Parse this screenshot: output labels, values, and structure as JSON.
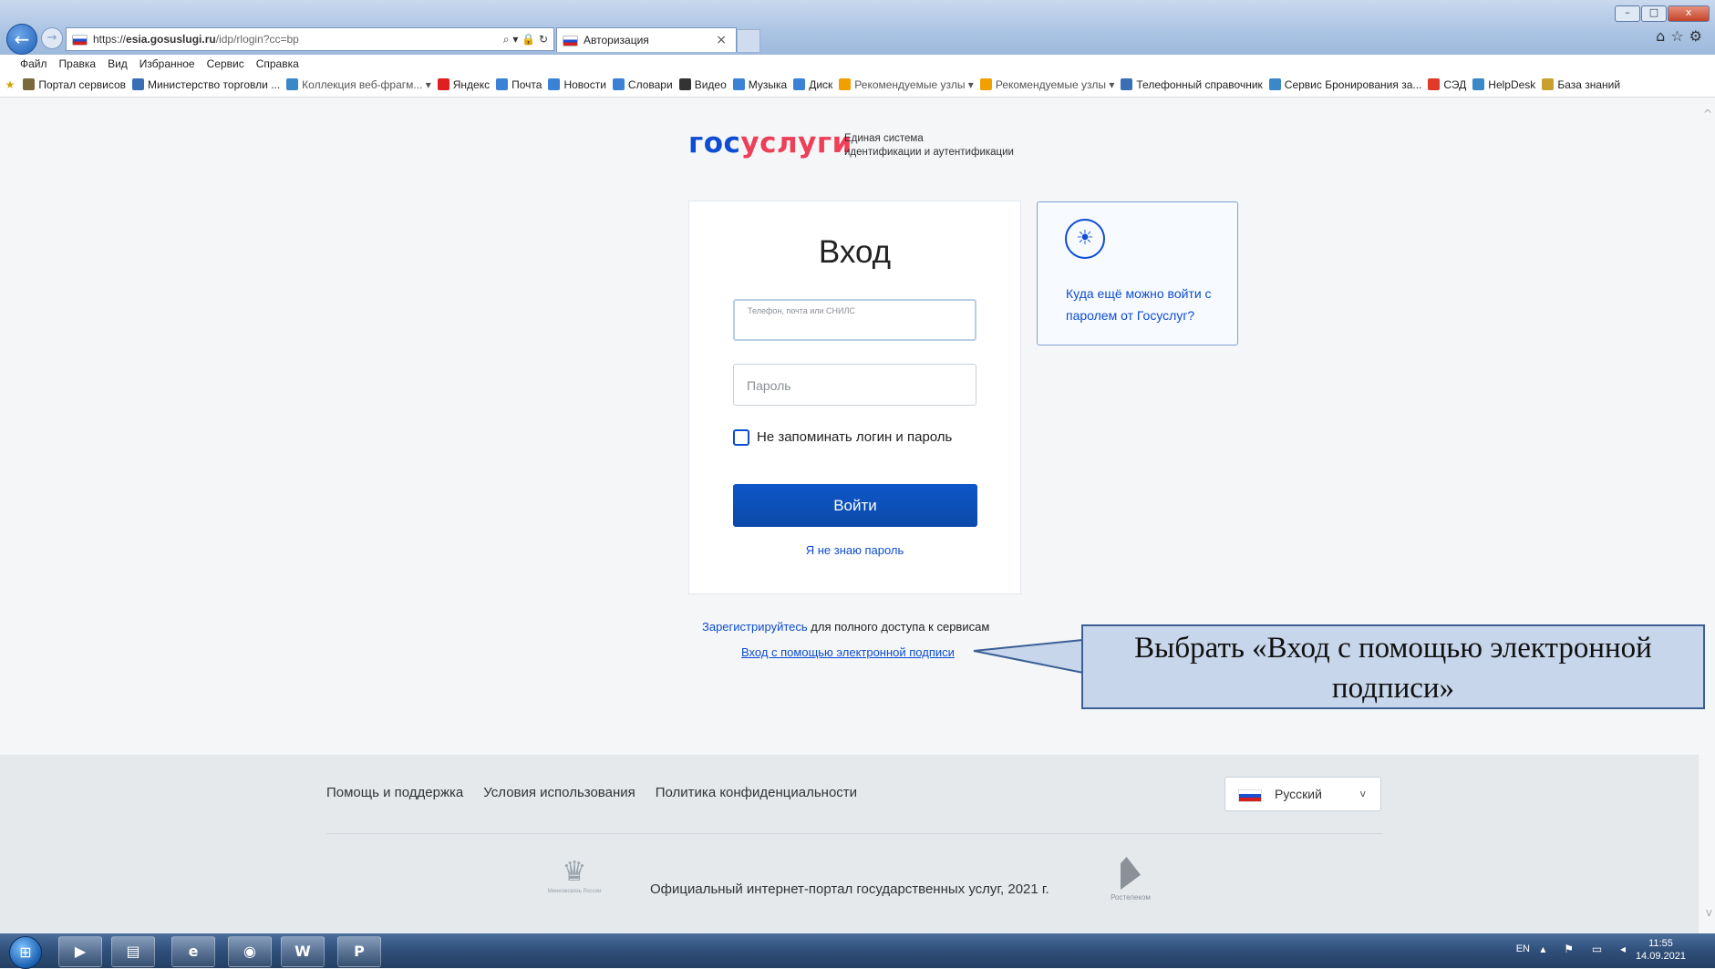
{
  "browser": {
    "url_prefix": "https://",
    "url_domain": "esia.gosuslugi.ru",
    "url_path": "/idp/rlogin?cc=bp",
    "tab_title": "Авторизация",
    "tab_close": "×",
    "window_controls": [
      "–",
      "□",
      "x"
    ],
    "menu": [
      "Файл",
      "Правка",
      "Вид",
      "Избранное",
      "Сервис",
      "Справка"
    ],
    "favorites": [
      {
        "label": "Портал сервисов",
        "color": "#7a6a3a",
        "muted": false
      },
      {
        "label": "Министерство торговли ...",
        "color": "#3a6fb5",
        "muted": false
      },
      {
        "label": "Коллекция веб-фрагм... ▾",
        "color": "#3a88c8",
        "muted": true
      },
      {
        "label": "Яндекс",
        "color": "#e02020",
        "muted": false
      },
      {
        "label": "Почта",
        "color": "#3b82d6",
        "muted": false
      },
      {
        "label": "Новости",
        "color": "#3b82d6",
        "muted": false
      },
      {
        "label": "Словари",
        "color": "#3b82d6",
        "muted": false
      },
      {
        "label": "Видео",
        "color": "#333333",
        "muted": false
      },
      {
        "label": "Музыка",
        "color": "#3b82d6",
        "muted": false
      },
      {
        "label": "Диск",
        "color": "#3b82d6",
        "muted": false
      },
      {
        "label": "Рекомендуемые узлы ▾",
        "color": "#f0a000",
        "muted": true
      },
      {
        "label": "Рекомендуемые узлы ▾",
        "color": "#f0a000",
        "muted": true
      },
      {
        "label": "Телефонный справочник",
        "color": "#3a6fb5",
        "muted": false
      },
      {
        "label": "Сервис Бронирования за...",
        "color": "#3a88c8",
        "muted": false
      },
      {
        "label": "СЭД",
        "color": "#e03a2a",
        "muted": false
      },
      {
        "label": "HelpDesk",
        "color": "#3a88c8",
        "muted": false
      },
      {
        "label": "База знаний",
        "color": "#c8a030",
        "muted": false
      }
    ]
  },
  "header": {
    "logo_part1": "гос",
    "logo_part2": "услуги",
    "subtitle_line1": "Единая система",
    "subtitle_line2": "идентификации и аутентификации"
  },
  "login": {
    "title": "Вход",
    "login_field_label": "Телефон, почта или СНИЛС",
    "password_placeholder": "Пароль",
    "remember_label": "Не запоминать логин и пароль",
    "submit_label": "Войти",
    "forgot_label": "Я не знаю пароль"
  },
  "info": {
    "text": "Куда ещё можно войти с паролем от Госуслуг?"
  },
  "register": {
    "link": "Зарегистрируйтесь",
    "rest": " для полного доступа к сервисам"
  },
  "esign_link": "Вход с помощью электронной подписи",
  "callout": {
    "text": "Выбрать «Вход с помощью электронной подписи»"
  },
  "footer": {
    "links": [
      "Помощь и поддержка",
      "Условия использования",
      "Политика конфиденциальности"
    ],
    "language": "Русский",
    "ministry_text": "Минкомсвязь России",
    "copyright": "Официальный интернет-портал государственных услуг, 2021 г.",
    "operator": "Ростелеком"
  },
  "taskbar": {
    "lang": "EN",
    "time": "11:55",
    "date": "14.09.2021"
  },
  "colors": {
    "brand_blue": "#0d4cd3",
    "brand_red": "#ee3f58"
  }
}
